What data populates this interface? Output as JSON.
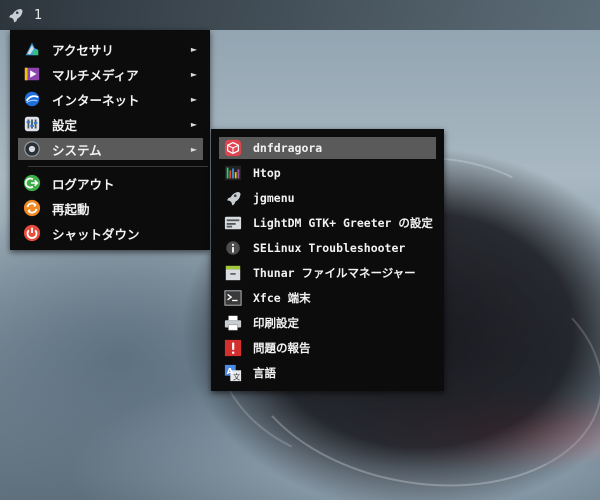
{
  "panel": {
    "workspace_number": "1",
    "launcher_icon": "rocket-icon"
  },
  "main_menu": {
    "items": [
      {
        "label": "アクセサリ",
        "icon": "accessories-icon",
        "submenu": true
      },
      {
        "label": "マルチメディア",
        "icon": "multimedia-icon",
        "submenu": true
      },
      {
        "label": "インターネット",
        "icon": "internet-icon",
        "submenu": true
      },
      {
        "label": "設定",
        "icon": "settings-icon",
        "submenu": true
      },
      {
        "label": "システム",
        "icon": "system-icon",
        "submenu": true,
        "selected": true
      },
      {
        "label": "ログアウト",
        "icon": "logout-icon"
      },
      {
        "label": "再起動",
        "icon": "restart-icon"
      },
      {
        "label": "シャットダウン",
        "icon": "shutdown-icon"
      }
    ],
    "arrow": "►"
  },
  "system_submenu": {
    "items": [
      {
        "label": "dnfdragora",
        "icon": "package-icon",
        "selected": true
      },
      {
        "label": "Htop",
        "icon": "htop-icon"
      },
      {
        "label": "jgmenu",
        "icon": "rocket-icon"
      },
      {
        "label": "LightDM GTK+ Greeter の設定",
        "icon": "display-settings-icon"
      },
      {
        "label": "SELinux Troubleshooter",
        "icon": "info-icon"
      },
      {
        "label": "Thunar ファイルマネージャー",
        "icon": "file-manager-icon"
      },
      {
        "label": "Xfce 端末",
        "icon": "terminal-icon"
      },
      {
        "label": "印刷設定",
        "icon": "printer-icon"
      },
      {
        "label": "問題の報告",
        "icon": "bug-report-icon"
      },
      {
        "label": "言語",
        "icon": "language-icon"
      }
    ]
  },
  "colors": {
    "menu_bg": "#0c0c0c",
    "selected_bg": "#5a5a5a",
    "logout_green": "#3fae49",
    "restart_orange": "#f08a24",
    "shutdown_red": "#e84c3d"
  }
}
